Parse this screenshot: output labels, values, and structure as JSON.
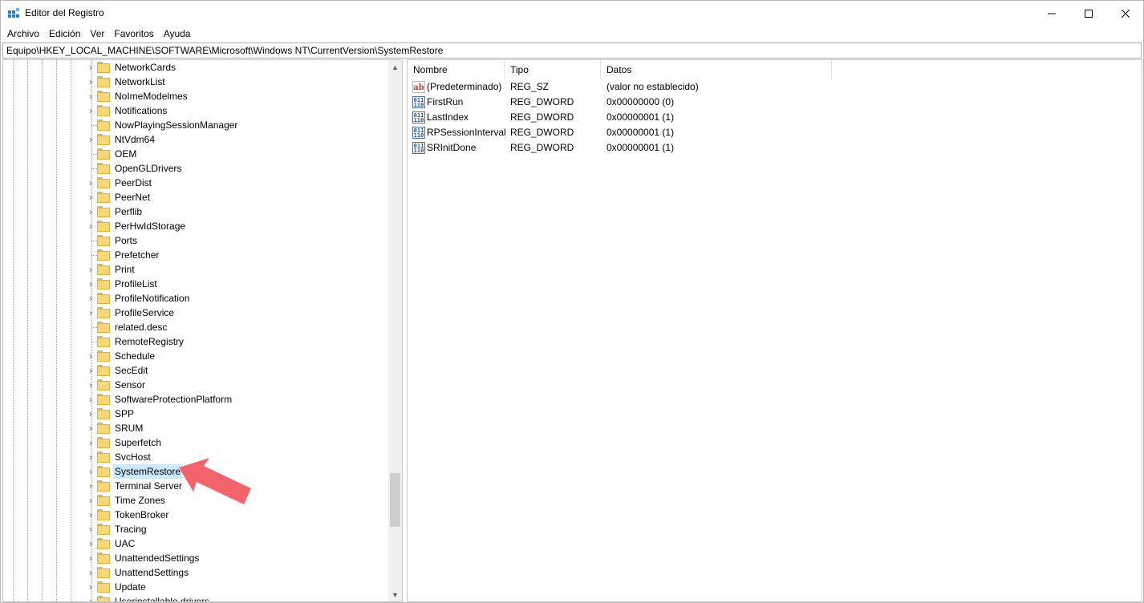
{
  "window": {
    "title": "Editor del Registro"
  },
  "menu": [
    "Archivo",
    "Edición",
    "Ver",
    "Favoritos",
    "Ayuda"
  ],
  "address": "Equipo\\HKEY_LOCAL_MACHINE\\SOFTWARE\\Microsoft\\Windows NT\\CurrentVersion\\SystemRestore",
  "tree": {
    "items": [
      {
        "label": "NetworkCards",
        "expandable": true
      },
      {
        "label": "NetworkList",
        "expandable": true
      },
      {
        "label": "NoImeModelmes",
        "expandable": true
      },
      {
        "label": "Notifications",
        "expandable": true
      },
      {
        "label": "NowPlayingSessionManager",
        "expandable": false
      },
      {
        "label": "NtVdm64",
        "expandable": true
      },
      {
        "label": "OEM",
        "expandable": false
      },
      {
        "label": "OpenGLDrivers",
        "expandable": false
      },
      {
        "label": "PeerDist",
        "expandable": true
      },
      {
        "label": "PeerNet",
        "expandable": true
      },
      {
        "label": "Perflib",
        "expandable": true
      },
      {
        "label": "PerHwIdStorage",
        "expandable": true
      },
      {
        "label": "Ports",
        "expandable": false
      },
      {
        "label": "Prefetcher",
        "expandable": false
      },
      {
        "label": "Print",
        "expandable": true
      },
      {
        "label": "ProfileList",
        "expandable": true
      },
      {
        "label": "ProfileNotification",
        "expandable": true
      },
      {
        "label": "ProfileService",
        "expandable": true
      },
      {
        "label": "related.desc",
        "expandable": false
      },
      {
        "label": "RemoteRegistry",
        "expandable": false
      },
      {
        "label": "Schedule",
        "expandable": true
      },
      {
        "label": "SecEdit",
        "expandable": true
      },
      {
        "label": "Sensor",
        "expandable": true
      },
      {
        "label": "SoftwareProtectionPlatform",
        "expandable": true
      },
      {
        "label": "SPP",
        "expandable": true
      },
      {
        "label": "SRUM",
        "expandable": true
      },
      {
        "label": "Superfetch",
        "expandable": true
      },
      {
        "label": "SvcHost",
        "expandable": true
      },
      {
        "label": "SystemRestore",
        "expandable": true,
        "selected": true
      },
      {
        "label": "Terminal Server",
        "expandable": true
      },
      {
        "label": "Time Zones",
        "expandable": true
      },
      {
        "label": "TokenBroker",
        "expandable": true
      },
      {
        "label": "Tracing",
        "expandable": true
      },
      {
        "label": "UAC",
        "expandable": true
      },
      {
        "label": "UnattendedSettings",
        "expandable": true
      },
      {
        "label": "UnattendSettings",
        "expandable": true
      },
      {
        "label": "Update",
        "expandable": true
      },
      {
        "label": "Userinstallable.drivers",
        "expandable": true
      }
    ]
  },
  "list": {
    "columns": [
      "Nombre",
      "Tipo",
      "Datos"
    ],
    "rows": [
      {
        "icon": "string-value-icon",
        "name": "(Predeterminado)",
        "type": "REG_SZ",
        "data": "(valor no establecido)"
      },
      {
        "icon": "dword-value-icon",
        "name": "FirstRun",
        "type": "REG_DWORD",
        "data": "0x00000000 (0)"
      },
      {
        "icon": "dword-value-icon",
        "name": "LastIndex",
        "type": "REG_DWORD",
        "data": "0x00000001 (1)"
      },
      {
        "icon": "dword-value-icon",
        "name": "RPSessionInterval",
        "type": "REG_DWORD",
        "data": "0x00000001 (1)"
      },
      {
        "icon": "dword-value-icon",
        "name": "SRInitDone",
        "type": "REG_DWORD",
        "data": "0x00000001 (1)"
      }
    ]
  },
  "colors": {
    "selection": "#cce8ff",
    "folder": "#f8d775",
    "annotation_arrow": "#f4636b"
  }
}
